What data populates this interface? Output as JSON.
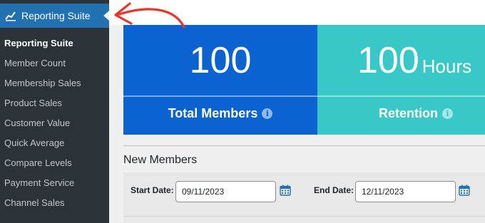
{
  "sidebar": {
    "menu_title": "Reporting Suite",
    "menu_icon": "chart-line-icon",
    "items": [
      {
        "label": "Reporting Suite",
        "active": true
      },
      {
        "label": "Member Count"
      },
      {
        "label": "Membership Sales"
      },
      {
        "label": "Product Sales"
      },
      {
        "label": "Customer Value"
      },
      {
        "label": "Quick Average"
      },
      {
        "label": "Compare Levels"
      },
      {
        "label": "Payment Service"
      },
      {
        "label": "Channel Sales"
      }
    ]
  },
  "stats": [
    {
      "value": "100",
      "unit": "",
      "label": "Total Members",
      "color": "#0a63d1"
    },
    {
      "value": "100",
      "unit": "Hours",
      "label": "Retention",
      "color": "#38c8c8"
    }
  ],
  "new_members": {
    "title": "New Members",
    "start_label": "Start Date:",
    "start_value": "09/11/2023",
    "end_label": "End Date:",
    "end_value": "12/11/2023"
  },
  "colors": {
    "sidebar_bg": "#2c3338",
    "menu_active_bg": "#2271b1",
    "annotation_arrow": "#e8352a",
    "calendar_icon": "#2271b1"
  }
}
